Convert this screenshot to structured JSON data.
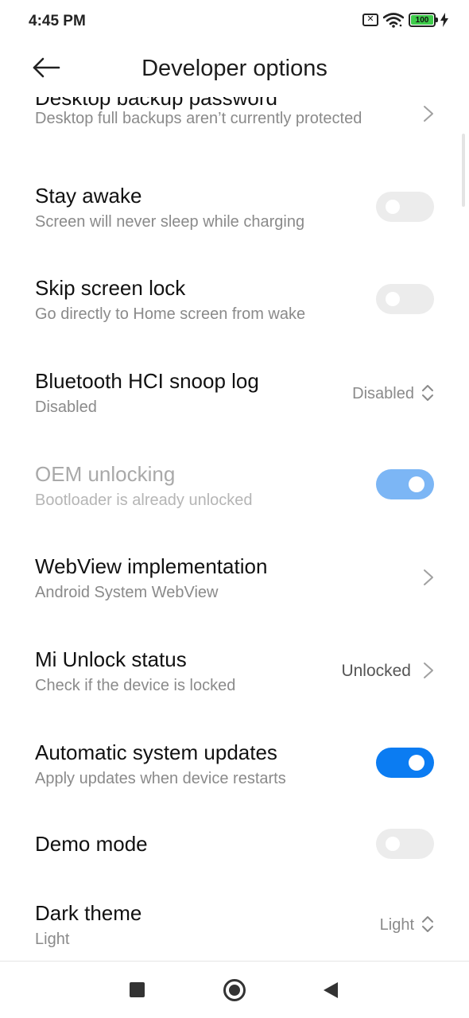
{
  "status": {
    "time": "4:45 PM",
    "battery_level": "100"
  },
  "header": {
    "title": "Developer options"
  },
  "items": [
    {
      "title": "Desktop backup password",
      "subtitle": "Desktop full backups aren’t currently protected"
    },
    {
      "title": "Stay awake",
      "subtitle": "Screen will never sleep while charging",
      "toggle": false
    },
    {
      "title": "Skip screen lock",
      "subtitle": "Go directly to Home screen from wake",
      "toggle": false
    },
    {
      "title": "Bluetooth HCI snoop log",
      "subtitle": "Disabled",
      "value": "Disabled"
    },
    {
      "title": "OEM unlocking",
      "subtitle": "Bootloader is already unlocked",
      "toggle": true,
      "disabled": true
    },
    {
      "title": "WebView implementation",
      "subtitle": "Android System WebView"
    },
    {
      "title": "Mi Unlock status",
      "subtitle": "Check if the device is locked",
      "value": "Unlocked"
    },
    {
      "title": "Automatic system updates",
      "subtitle": "Apply updates when device restarts",
      "toggle": true
    },
    {
      "title": "Demo mode",
      "toggle": false
    },
    {
      "title": "Dark theme",
      "subtitle": "Light",
      "value": "Light"
    }
  ],
  "colors": {
    "accent": "#0b7cf2",
    "accent_disabled": "#7cb6f5",
    "toggle_off": "#ececec",
    "subtitle": "#8a8a8a"
  },
  "icons": {
    "back": "arrow-left-icon",
    "chevron": "chevron-right-icon",
    "spinner": "up-down-chevron-icon",
    "wifi": "wifi-icon",
    "sim": "no-sim-icon",
    "battery": "battery-icon",
    "charging": "charging-bolt-icon"
  }
}
